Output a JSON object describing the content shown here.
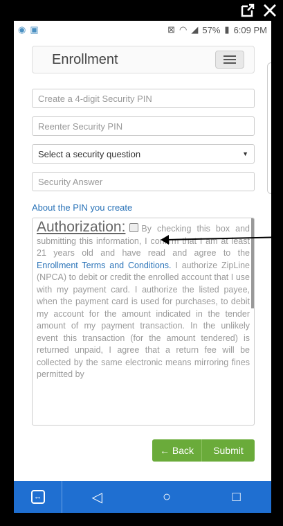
{
  "status": {
    "battery": "57%",
    "time": "6:09 PM"
  },
  "header": {
    "title": "Enrollment"
  },
  "fields": {
    "pin_placeholder": "Create a 4-digit Security PIN",
    "reenter_placeholder": "Reenter Security PIN",
    "question_selected": "Select a security question",
    "answer_placeholder": "Security Answer"
  },
  "about_link": "About the PIN you create",
  "authorization": {
    "heading": "Authorization:",
    "text_1": "By checking this box and submitting this information, I confirm that I am at least 21 years old and have read and agree to the ",
    "link": "Enrollment Terms and Conditions.",
    "text_2": " I authorize ZipLine (NPCA) to debit or credit the enrolled account that I use with my payment card. I authorize the listed payee, when the payment card is used for purchases, to debit my account for the amount indicated in the tender amount of my payment transaction. In the unlikely event this transaction (for the amount tendered) is returned unpaid, I agree that a return fee will be collected by the same electronic means mirroring fines permitted by"
  },
  "buttons": {
    "back": "← Back",
    "submit": "Submit"
  },
  "colors": {
    "accent": "#6aab3a",
    "link": "#2a73b8",
    "navbar": "#1f6fd1"
  }
}
